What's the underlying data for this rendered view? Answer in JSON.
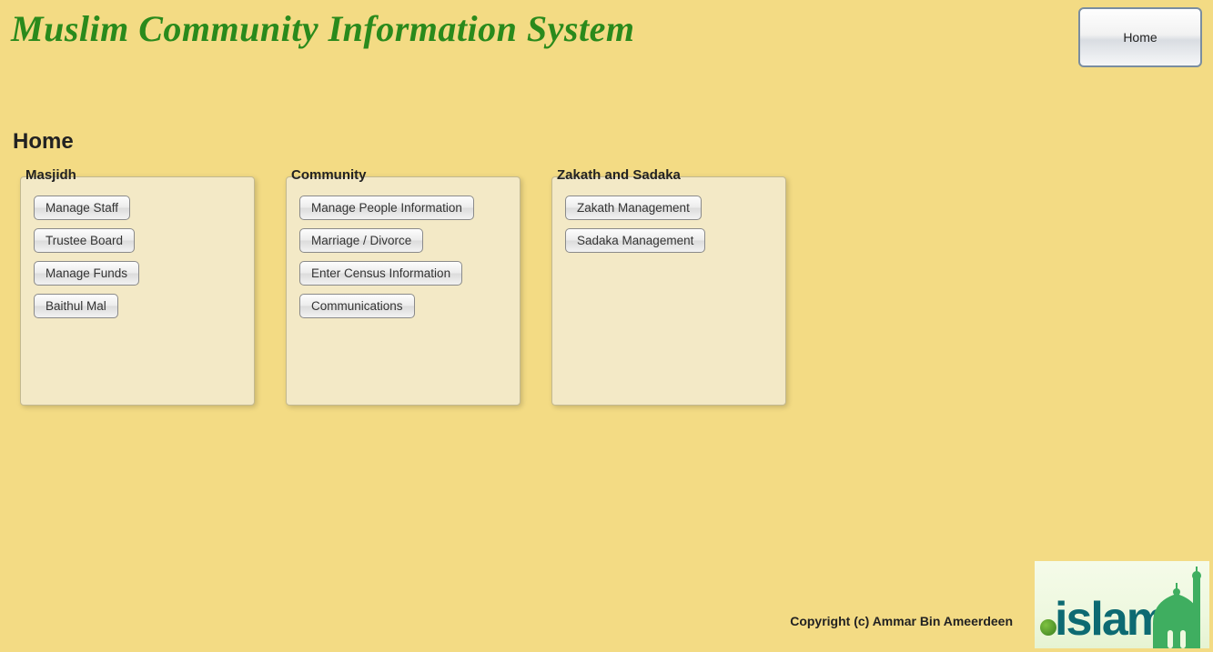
{
  "header": {
    "app_title": "Muslim Community Information System",
    "home_nav": "Home"
  },
  "page": {
    "heading": "Home"
  },
  "panels": [
    {
      "legend": "Masjidh",
      "buttons": [
        "Manage Staff",
        "Trustee Board",
        "Manage Funds",
        "Baithul Mal"
      ]
    },
    {
      "legend": "Community",
      "buttons": [
        "Manage People Information",
        "Marriage / Divorce",
        "Enter Census Information",
        "Communications"
      ]
    },
    {
      "legend": "Zakath and Sadaka",
      "buttons": [
        "Zakath Management",
        "Sadaka Management"
      ]
    }
  ],
  "footer": {
    "copyright": "Copyright (c) Ammar Bin Ameerdeen",
    "logo_text": "islam"
  }
}
